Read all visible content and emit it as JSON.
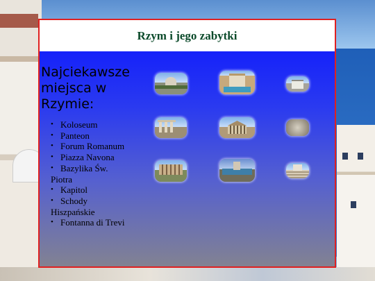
{
  "slide": {
    "title": "Rzym i jego zabytki",
    "heading": "Najciekawsze miejsca w Rzymie:",
    "items": [
      {
        "label": "Koloseum"
      },
      {
        "label": "Panteon"
      },
      {
        "label": "Forum Romanum"
      },
      {
        "label": "Piazza Navona"
      },
      {
        "label": "Bazylika Św.",
        "cont": "Piotra"
      },
      {
        "label": "Kapitol"
      },
      {
        "label": "Schody",
        "cont": "Hiszpańskie"
      },
      {
        "label": "Fontanna di Trevi"
      }
    ]
  },
  "colors": {
    "border": "#e02020",
    "title_text": "#0b4a2a",
    "panel_top": "#0a14ff",
    "panel_bottom": "#828292"
  }
}
